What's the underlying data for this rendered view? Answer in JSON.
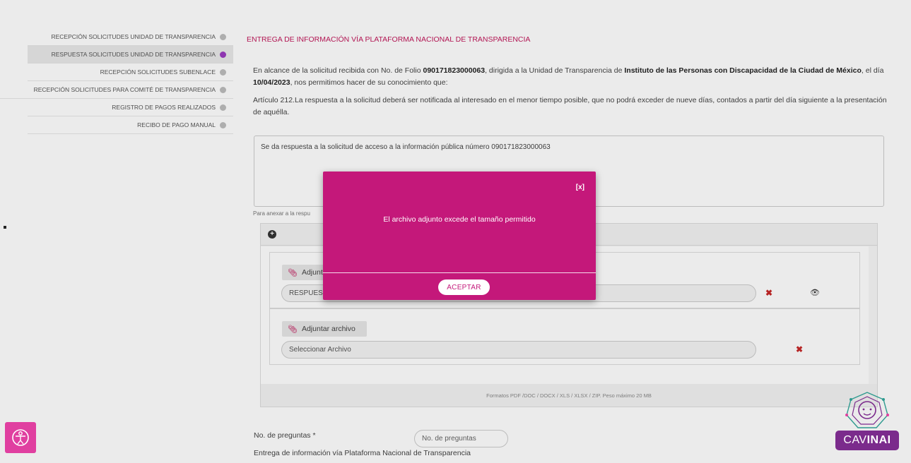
{
  "sidebar": {
    "items": [
      {
        "label": "RECEPCIÓN SOLICITUDES UNIDAD DE TRANSPARENCIA"
      },
      {
        "label": "RESPUESTA SOLICITUDES UNIDAD DE TRANSPARENCIA"
      },
      {
        "label": "RECEPCIÓN SOLICITUDES SUBENLACE"
      },
      {
        "label": "RECEPCIÓN SOLICITUDES PARA COMITÉ DE TRANSPARENCIA"
      },
      {
        "label": "REGISTRO DE PAGOS REALIZADOS"
      },
      {
        "label": "RECIBO DE PAGO MANUAL"
      }
    ]
  },
  "main": {
    "title": "ENTREGA DE INFORMACIÓN VÍA PLATAFORMA NACIONAL DE TRANSPARENCIA",
    "intro_1": "En alcance de la solicitud recibida con No. de Folio ",
    "folio": "090171823000063",
    "intro_2": ", dirigida a la Unidad de Transparencia de ",
    "institution": "Instituto de las Personas con Discapacidad de la Ciudad de México",
    "intro_3": ", el día ",
    "date": "10/04/2023",
    "intro_4": ", nos permitimos hacer de su conocimiento que:",
    "article": "Artículo 212.La respuesta a la solicitud deberá ser notificada al interesado en el menor tiempo posible, que no podrá exceder de nueve días, contados a partir del día siguiente a la presentación de aquélla.",
    "response_text": "Se da respuesta a la solicitud de acceso a la información pública número 090171823000063",
    "attach_hint": "Para anexar a la respu",
    "attach_button_1": "Adjunt",
    "file_value_1": "RESPUEST",
    "attach_button_2": "Adjuntar archivo",
    "file_placeholder_2": "Seleccionar Archivo",
    "formats_note": "Formatos PDF /DOC / DOCX / XLS / XLSX / ZIP. Peso máximo 20 MB",
    "questions_label": "No. de preguntas *",
    "questions_placeholder": "No. de preguntas",
    "delivery_text": "Entrega de información vía Plataforma Nacional de Transparencia"
  },
  "modal": {
    "close_label": "[x]",
    "message": "El archivo adjunto excede el tamaño permitido",
    "accept_label": "ACEPTAR"
  },
  "branding": {
    "cav_prefix": "CAV",
    "cav_suffix": "INAI"
  },
  "colors": {
    "accent": "#c4187a",
    "title": "#c2185b",
    "active_dot": "#9b3bbf",
    "cav_purple": "#7b2b8c"
  }
}
